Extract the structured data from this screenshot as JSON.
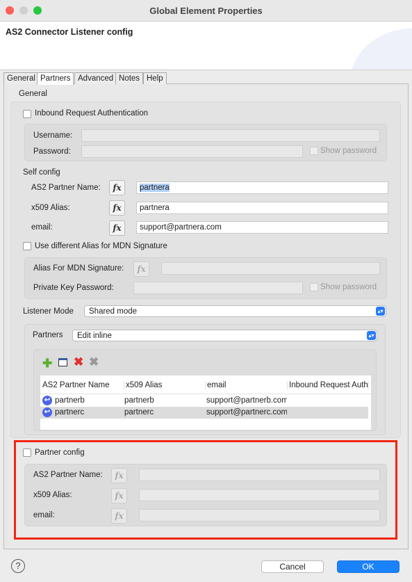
{
  "window": {
    "title": "Global Element Properties"
  },
  "header": {
    "title": "AS2 Connector Listener config"
  },
  "tabs": [
    {
      "label": "General"
    },
    {
      "label": "Partners",
      "active": true
    },
    {
      "label": "Advanced"
    },
    {
      "label": "Notes"
    },
    {
      "label": "Help"
    }
  ],
  "general": {
    "section_label": "General",
    "inbound_auth": {
      "label": "Inbound Request Authentication",
      "checked": false,
      "username_label": "Username:",
      "username_value": "",
      "password_label": "Password:",
      "password_value": "",
      "show_password_label": "Show password"
    },
    "self_config": {
      "label": "Self config",
      "partner_name_label": "AS2 Partner Name:",
      "partner_name_value": "partnera",
      "alias_label": "x509 Alias:",
      "alias_value": "partnera",
      "email_label": "email:",
      "email_value": "support@partnera.com"
    },
    "mdn": {
      "label": "Use different Alias for MDN Signature",
      "checked": false,
      "alias_label": "Alias For MDN Signature:",
      "alias_value": "",
      "key_password_label": "Private Key Password:",
      "key_password_value": "",
      "show_password_label": "Show password"
    },
    "listener_mode": {
      "label": "Listener Mode",
      "value": "Shared mode"
    },
    "partners": {
      "label": "Partners",
      "value": "Edit inline",
      "toolbar": [
        "add-icon",
        "edit-icon",
        "delete-icon",
        "delete-all-icon"
      ],
      "columns": [
        "AS2 Partner Name",
        "x509 Alias",
        "email",
        "Inbound Request Auth"
      ],
      "rows": [
        {
          "name": "partnerb",
          "alias": "partnerb",
          "email": "support@partnerb.com"
        },
        {
          "name": "partnerc",
          "alias": "partnerc",
          "email": "support@partnerc.com",
          "selected": true
        }
      ]
    }
  },
  "partner_config": {
    "label": "Partner config",
    "checked": false,
    "partner_name_label": "AS2 Partner Name:",
    "alias_label": "x509 Alias:",
    "email_label": "email:"
  },
  "fx_label": "fx",
  "footer": {
    "help_icon": "?",
    "cancel": "Cancel",
    "ok": "OK"
  },
  "colors": {
    "accent": "#2a7cf6",
    "highlight_border": "#f0260f"
  }
}
